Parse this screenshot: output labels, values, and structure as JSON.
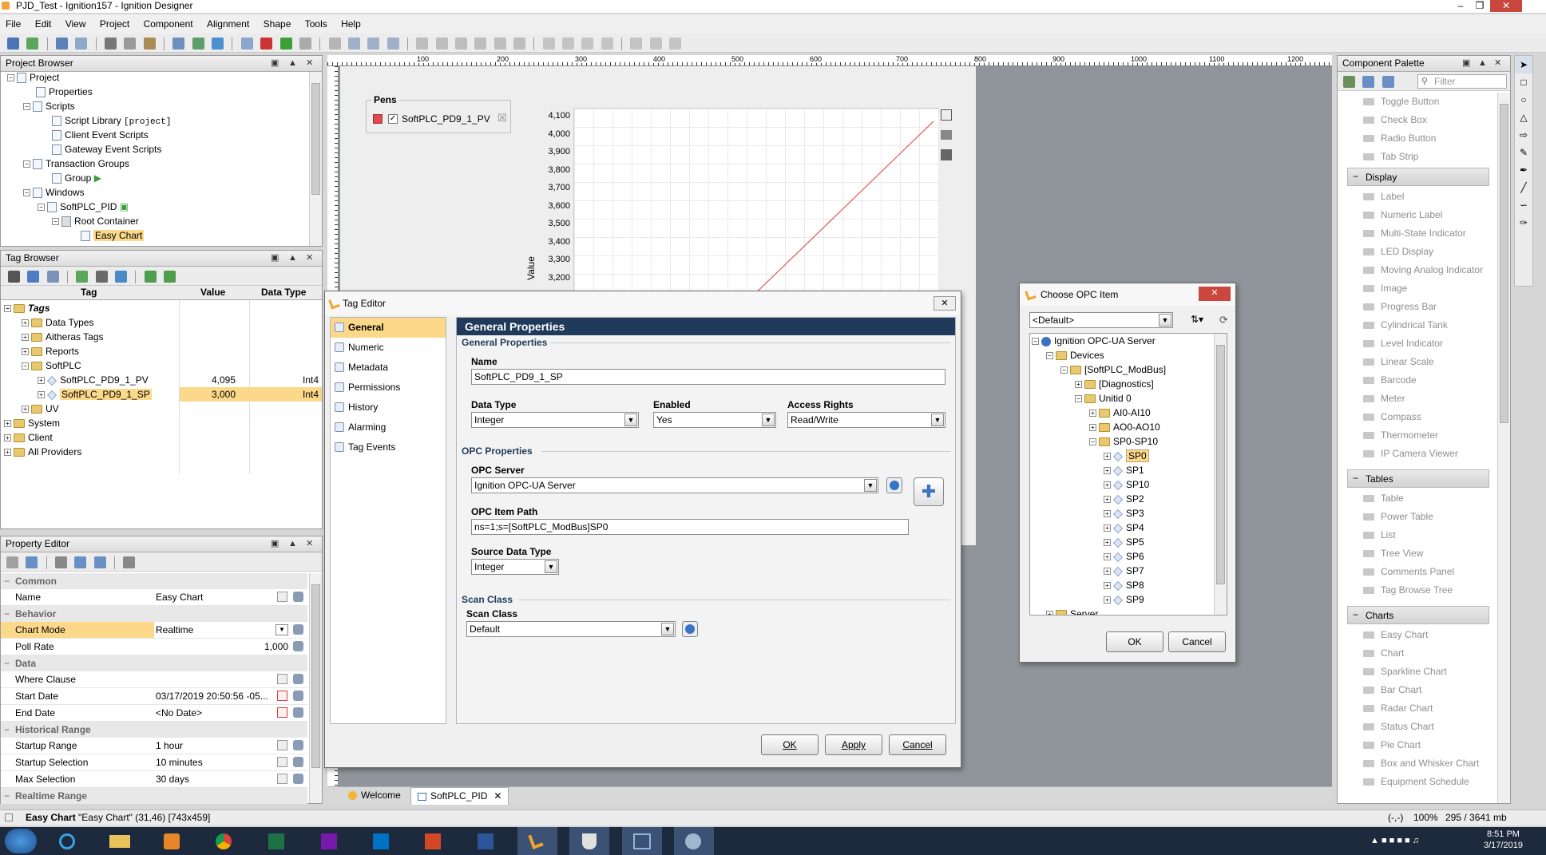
{
  "window": {
    "title": "PJD_Test - Ignition157 - Ignition Designer"
  },
  "menu": [
    "File",
    "Edit",
    "View",
    "Project",
    "Component",
    "Alignment",
    "Shape",
    "Tools",
    "Help"
  ],
  "project_browser": {
    "title": "Project Browser",
    "items": [
      "Project",
      "Properties",
      "Scripts",
      "Script Library",
      "[project]",
      "Client Event Scripts",
      "Gateway Event Scripts",
      "Transaction Groups",
      "Group",
      "Windows",
      "SoftPLC_PID",
      "Root Container",
      "Easy Chart"
    ]
  },
  "tag_browser": {
    "title": "Tag Browser",
    "columns": [
      "Tag",
      "Value",
      "Data Type"
    ],
    "rows": [
      {
        "name": "Tags",
        "value": "",
        "type": ""
      },
      {
        "name": "Data Types",
        "value": "",
        "type": ""
      },
      {
        "name": "Aitheras Tags",
        "value": "",
        "type": ""
      },
      {
        "name": "Reports",
        "value": "",
        "type": ""
      },
      {
        "name": "SoftPLC",
        "value": "",
        "type": ""
      },
      {
        "name": "SoftPLC_PD9_1_PV",
        "value": "4,095",
        "type": "Int4"
      },
      {
        "name": "SoftPLC_PD9_1_SP",
        "value": "3,000",
        "type": "Int4"
      },
      {
        "name": "UV",
        "value": "",
        "type": ""
      },
      {
        "name": "System",
        "value": "",
        "type": ""
      },
      {
        "name": "Client",
        "value": "",
        "type": ""
      },
      {
        "name": "All Providers",
        "value": "",
        "type": ""
      }
    ]
  },
  "property_editor": {
    "title": "Property Editor",
    "common": "Common",
    "name_label": "Name",
    "name_value": "Easy Chart",
    "behavior": "Behavior",
    "chart_mode_label": "Chart Mode",
    "chart_mode_value": "Realtime",
    "poll_rate_label": "Poll Rate",
    "poll_rate_value": "1,000",
    "data": "Data",
    "where_label": "Where Clause",
    "start_label": "Start Date",
    "start_value": "03/17/2019 20:50:56 -05...",
    "end_label": "End Date",
    "end_value": "<No Date>",
    "historical": "Historical Range",
    "startup_range_label": "Startup Range",
    "startup_range_value": "1 hour",
    "startup_sel_label": "Startup Selection",
    "startup_sel_value": "10 minutes",
    "max_sel_label": "Max Selection",
    "max_sel_value": "30 days",
    "realtime": "Realtime Range"
  },
  "canvas": {
    "pens_title": "Pens",
    "pen_name": "SoftPLC_PD9_1_PV",
    "ruler_labels": [
      "100",
      "200",
      "300",
      "400",
      "500",
      "600",
      "700",
      "800",
      "900",
      "1000",
      "1100",
      "1200"
    ],
    "tabs": [
      "Welcome",
      "SoftPLC_PID"
    ]
  },
  "chart_data": {
    "type": "line",
    "ylabel": "Value",
    "y_ticks": [
      "4,100",
      "4,000",
      "3,900",
      "3,800",
      "3,700",
      "3,600",
      "3,500",
      "3,400",
      "3,300",
      "3,200"
    ],
    "ylim": [
      3200,
      4100
    ],
    "grid": true,
    "series": [
      {
        "name": "SoftPLC_PD9_1_PV",
        "color": "#e06666"
      }
    ]
  },
  "tag_editor": {
    "title": "Tag Editor",
    "nav": [
      "General",
      "Numeric",
      "Metadata",
      "Permissions",
      "History",
      "Alarming",
      "Tag Events"
    ],
    "header": "General Properties",
    "section_general": "General Properties",
    "name_label": "Name",
    "name_value": "SoftPLC_PD9_1_SP",
    "datatype_label": "Data Type",
    "datatype_value": "Integer",
    "enabled_label": "Enabled",
    "enabled_value": "Yes",
    "access_label": "Access Rights",
    "access_value": "Read/Write",
    "section_opc": "OPC Properties",
    "opcserver_label": "OPC Server",
    "opcserver_value": "Ignition OPC-UA Server",
    "itempath_label": "OPC Item Path",
    "itempath_value": "ns=1;s=[SoftPLC_ModBus]SP0",
    "srctype_label": "Source Data Type",
    "srctype_value": "Integer",
    "section_scan": "Scan Class",
    "scan_label": "Scan Class",
    "scan_value": "Default",
    "ok": "OK",
    "apply": "Apply",
    "cancel": "Cancel"
  },
  "opc_dialog": {
    "title": "Choose OPC Item",
    "filter_value": "<Default>",
    "tree": [
      "Ignition OPC-UA Server",
      "Devices",
      "[SoftPLC_ModBus]",
      "[Diagnostics]",
      "Unitid 0",
      "AI0-AI10",
      "AO0-AO10",
      "SP0-SP10",
      "SP0",
      "SP1",
      "SP10",
      "SP2",
      "SP3",
      "SP4",
      "SP5",
      "SP6",
      "SP7",
      "SP8",
      "SP9",
      "Server"
    ],
    "ok": "OK",
    "cancel": "Cancel"
  },
  "palette": {
    "title": "Component Palette",
    "filter_placeholder": "Filter",
    "input_items": [
      "Toggle Button",
      "Check Box",
      "Radio Button",
      "Tab Strip"
    ],
    "display_title": "Display",
    "display_items": [
      "Label",
      "Numeric Label",
      "Multi-State Indicator",
      "LED Display",
      "Moving Analog Indicator",
      "Image",
      "Progress Bar",
      "Cylindrical Tank",
      "Level Indicator",
      "Linear Scale",
      "Barcode",
      "Meter",
      "Compass",
      "Thermometer",
      "IP Camera Viewer"
    ],
    "tables_title": "Tables",
    "tables_items": [
      "Table",
      "Power Table",
      "List",
      "Tree View",
      "Comments Panel",
      "Tag Browse Tree"
    ],
    "charts_title": "Charts",
    "charts_items": [
      "Easy Chart",
      "Chart",
      "Sparkline Chart",
      "Bar Chart",
      "Radar Chart",
      "Status Chart",
      "Pie Chart",
      "Box and Whisker Chart",
      "Equipment Schedule"
    ]
  },
  "status": {
    "left_bold": "Easy Chart",
    "left_rest": "\"Easy Chart\" (31,46) [743x459]",
    "coords": "(-,-)",
    "zoom": "100%",
    "memory": "295 / 3641 mb"
  },
  "taskbar": {
    "time": "8:51 PM",
    "date": "3/17/2019"
  }
}
